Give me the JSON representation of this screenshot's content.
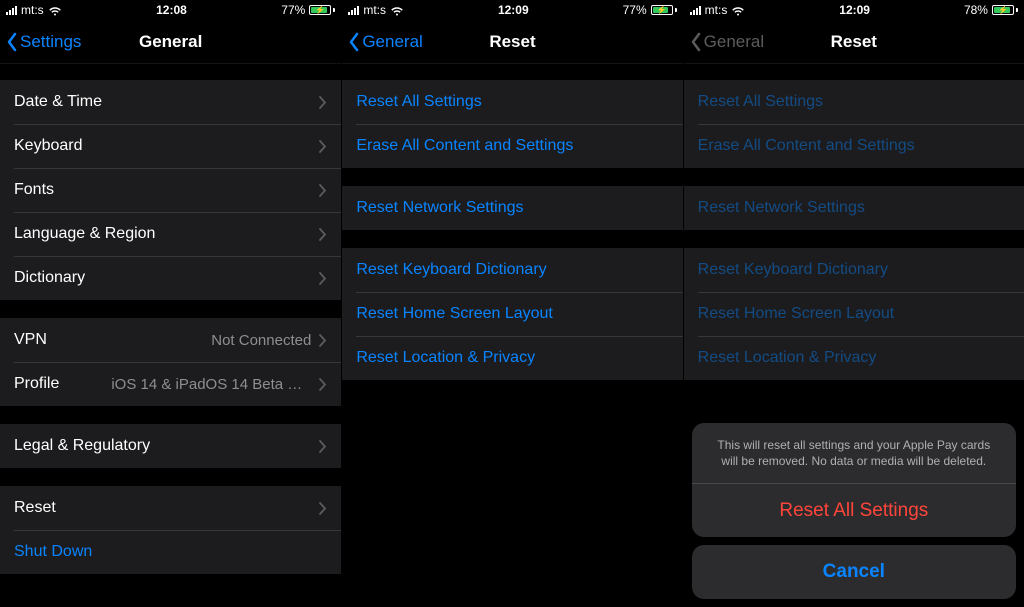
{
  "pane1": {
    "status": {
      "carrier": "mt:s",
      "time": "12:08",
      "battery_pct": "77%",
      "battery_fill": 77
    },
    "back": "Settings",
    "title": "General",
    "groups": [
      {
        "rows": [
          {
            "label": "Date & Time",
            "chevron": true
          },
          {
            "label": "Keyboard",
            "chevron": true
          },
          {
            "label": "Fonts",
            "chevron": true
          },
          {
            "label": "Language & Region",
            "chevron": true
          },
          {
            "label": "Dictionary",
            "chevron": true
          }
        ]
      },
      {
        "rows": [
          {
            "label": "VPN",
            "detail": "Not Connected",
            "chevron": true
          },
          {
            "label": "Profile",
            "detail": "iOS 14 & iPadOS 14 Beta Softwar...",
            "chevron": true
          }
        ]
      },
      {
        "rows": [
          {
            "label": "Legal & Regulatory",
            "chevron": true
          }
        ]
      },
      {
        "rows": [
          {
            "label": "Reset",
            "chevron": true
          },
          {
            "label": "Shut Down",
            "blue": true
          }
        ]
      }
    ]
  },
  "pane2": {
    "status": {
      "carrier": "mt:s",
      "time": "12:09",
      "battery_pct": "77%",
      "battery_fill": 77
    },
    "back": "General",
    "title": "Reset",
    "groups": [
      {
        "rows": [
          {
            "label": "Reset All Settings"
          },
          {
            "label": "Erase All Content and Settings"
          }
        ]
      },
      {
        "rows": [
          {
            "label": "Reset Network Settings"
          }
        ]
      },
      {
        "rows": [
          {
            "label": "Reset Keyboard Dictionary"
          },
          {
            "label": "Reset Home Screen Layout"
          },
          {
            "label": "Reset Location & Privacy"
          }
        ]
      }
    ]
  },
  "pane3": {
    "status": {
      "carrier": "mt:s",
      "time": "12:09",
      "battery_pct": "78%",
      "battery_fill": 78
    },
    "back": "General",
    "title": "Reset",
    "groups": [
      {
        "rows": [
          {
            "label": "Reset All Settings"
          },
          {
            "label": "Erase All Content and Settings"
          }
        ]
      },
      {
        "rows": [
          {
            "label": "Reset Network Settings"
          }
        ]
      },
      {
        "rows": [
          {
            "label": "Reset Keyboard Dictionary"
          },
          {
            "label": "Reset Home Screen Layout"
          },
          {
            "label": "Reset Location & Privacy"
          }
        ]
      }
    ],
    "sheet": {
      "message": "This will reset all settings and your Apple Pay cards will be removed. No data or media will be deleted.",
      "action": "Reset All Settings",
      "cancel": "Cancel"
    }
  }
}
